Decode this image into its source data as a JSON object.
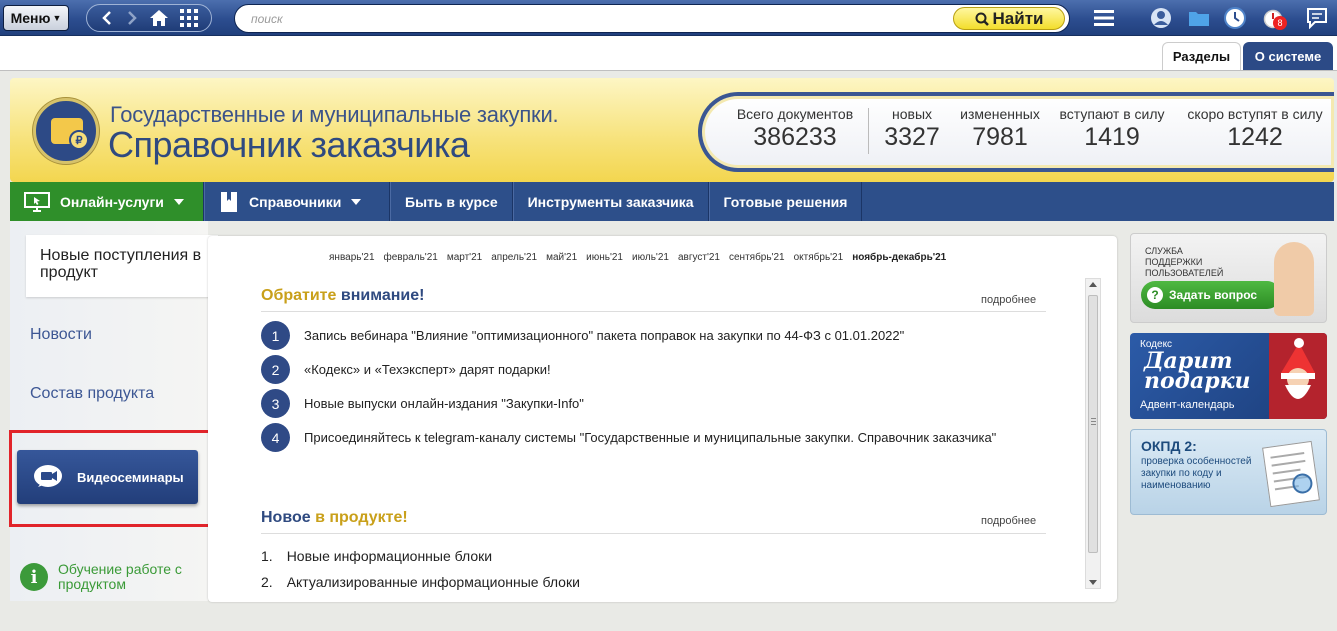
{
  "topbar": {
    "menu_label": "Меню",
    "search_placeholder": "поиск",
    "find_label": "Найти",
    "notification_count": "8"
  },
  "tabs": {
    "razdely": "Разделы",
    "o_sisteme": "О системе"
  },
  "banner": {
    "title_line1": "Государственные и муниципальные закупки.",
    "title_line2": "Справочник заказчика",
    "stats": [
      {
        "label": "Всего документов",
        "value": "386233"
      },
      {
        "label": "новых",
        "value": "3327"
      },
      {
        "label": "измененных",
        "value": "7981"
      },
      {
        "label": "вступают в силу",
        "value": "1419"
      },
      {
        "label": "скоро вступят в силу",
        "value": "1242"
      }
    ]
  },
  "nav": {
    "items": [
      "Онлайн-услуги",
      "Справочники",
      "Быть в курсе",
      "Инструменты заказчика",
      "Готовые решения"
    ]
  },
  "sidebar": {
    "new_arrivals": "Новые поступления в продукт",
    "news": "Новости",
    "composition": "Состав продукта",
    "video": "Видеосеминары",
    "training": "Обучение работе с продуктом"
  },
  "content": {
    "months": [
      "январь'21",
      "февраль'21",
      "март'21",
      "апрель'21",
      "май'21",
      "июнь'21",
      "июль'21",
      "август'21",
      "сентябрь'21",
      "октябрь'21",
      "ноябрь-декабрь'21"
    ],
    "attention_part1": "Обратите",
    "attention_part2": " внимание!",
    "more": "подробнее",
    "attention_items": [
      "Запись вебинара \"Влияние \"оптимизационного\" пакета поправок на закупки по 44-ФЗ с 01.01.2022\"",
      "«Кодекс» и «Техэксперт» дарят подарки!",
      "Новые выпуски онлайн-издания \"Закупки-Info\"",
      "Присоединяйтесь к telegram-каналу системы \"Государственные и муниципальные закупки. Справочник заказчика\""
    ],
    "new_part1": "Новое",
    "new_part2": " в продукте!",
    "new_items": [
      "Новые информационные блоки",
      "Актуализированные информационные блоки"
    ]
  },
  "promos": {
    "support_text": "Служба поддержки пользователей",
    "ask_button": "Задать вопрос",
    "gifts_brand": "Кодекс",
    "gifts_big": "Дарит подарки",
    "gifts_sub": "Адвент-календарь",
    "okpd_title": "ОКПД 2:",
    "okpd_desc": "проверка особенностей закупки по коду и наименованию"
  },
  "colors": {
    "brand_blue": "#2d4f8a",
    "green": "#2f8f2a",
    "gold": "#c9a01a",
    "highlight_red": "#e1242a"
  }
}
